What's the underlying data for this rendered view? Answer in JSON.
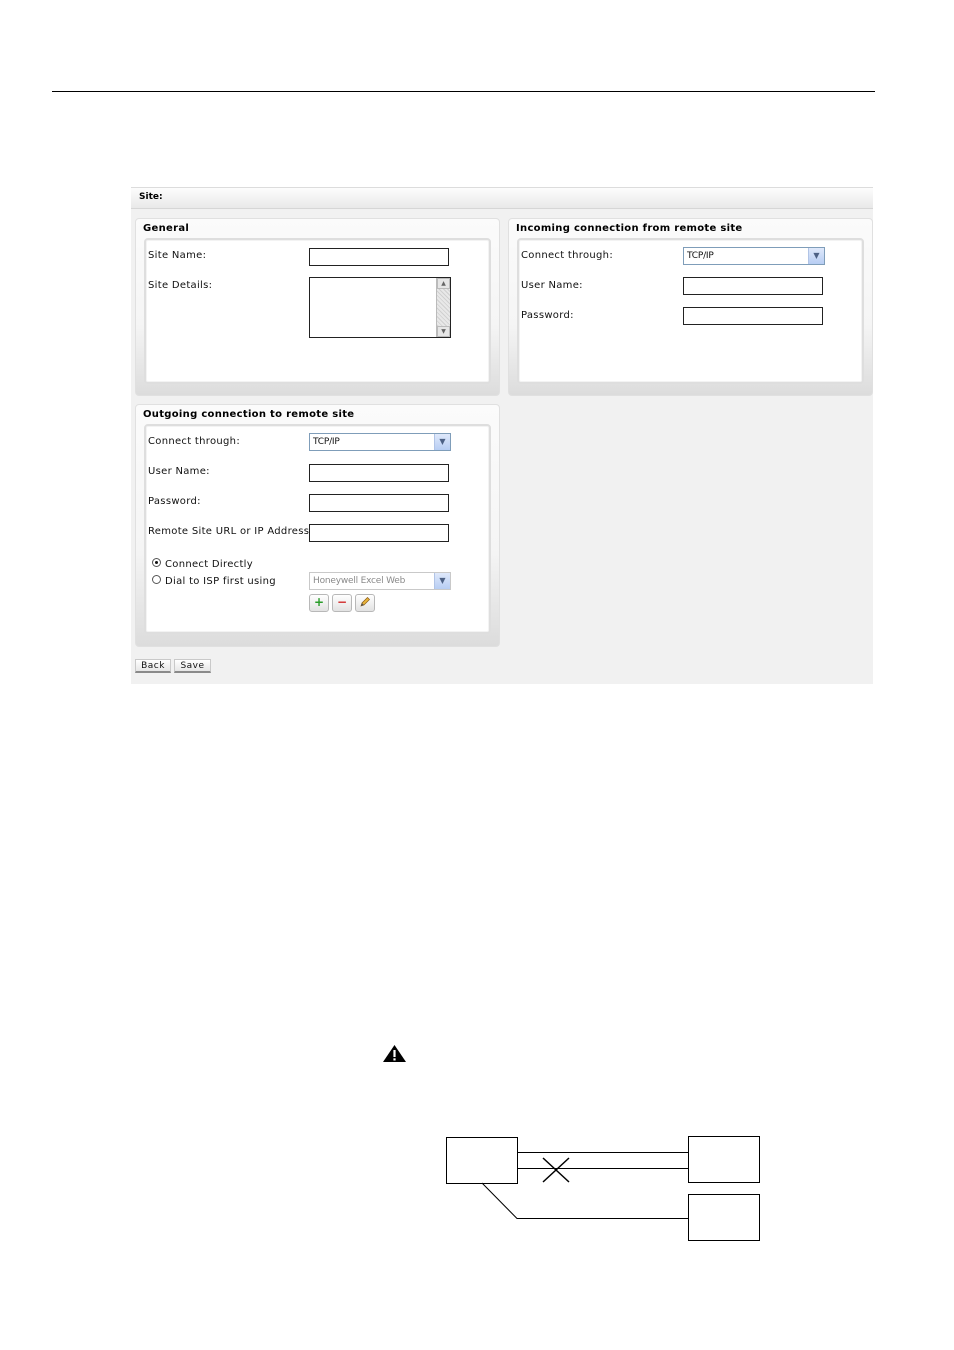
{
  "app": {
    "title": "Site:"
  },
  "general": {
    "title": "General",
    "site_name_label": "Site Name:",
    "site_name_value": "",
    "site_details_label": "Site Details:",
    "site_details_value": ""
  },
  "incoming": {
    "title": "Incoming connection from remote site",
    "connect_label": "Connect through:",
    "connect_value": "TCP/IP",
    "user_label": "User Name:",
    "user_value": "",
    "password_label": "Password:",
    "password_value": ""
  },
  "outgoing": {
    "title": "Outgoing connection to remote site",
    "connect_label": "Connect through:",
    "connect_value": "TCP/IP",
    "user_label": "User Name:",
    "password_label": "Password:",
    "url_label": "Remote Site URL or IP Address:",
    "radio_direct_label": "Connect Directly",
    "radio_direct_checked": true,
    "radio_dial_label": "Dial to ISP first using",
    "radio_dial_checked": false,
    "isp_value": "Honeywell Excel Web",
    "add_icon": "plus-icon",
    "remove_icon": "minus-icon",
    "edit_icon": "pencil-icon"
  },
  "buttons": {
    "back": "Back",
    "save": "Save"
  },
  "colors": {
    "add_green": "#2a9d2a",
    "remove_red": "#d02a2a",
    "select_border": "#7f9db9"
  }
}
